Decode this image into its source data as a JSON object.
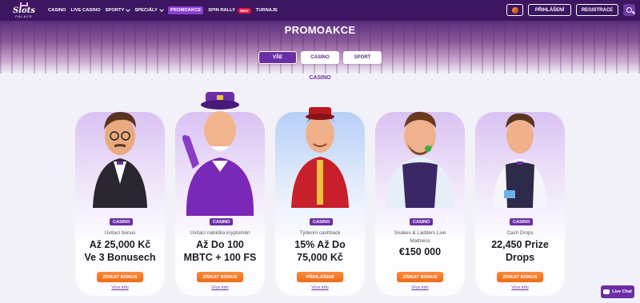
{
  "brand": {
    "name": "Slots",
    "sub": "PALACE"
  },
  "nav": {
    "items": [
      {
        "label": "CASINO"
      },
      {
        "label": "LIVE CASINO"
      },
      {
        "label": "SPORTY"
      },
      {
        "label": "SPECIÁLY"
      },
      {
        "label": "PROMOAKCE"
      },
      {
        "label": "SPIN RALLY"
      },
      {
        "label": "TURNAJE"
      }
    ],
    "new_badge": "NEW",
    "login": "PŘIHLÁŠENÍ",
    "register": "REGISTRACE"
  },
  "hero": {
    "title": "PROMOAKCE"
  },
  "filters": [
    "VŠE",
    "CASINO",
    "SPORT"
  ],
  "section_label": "CASINO",
  "cards": [
    {
      "tag": "CASINO",
      "subtitle": "Uvítací bonus",
      "title_1": "Až 25,000 Kč",
      "title_2": "Ve 3 Bonusech",
      "button": "ZÍSKAT BONUS",
      "link": "Více info"
    },
    {
      "tag": "CASINO",
      "subtitle": "Uvítací nabídka kryptoměn",
      "title_1": "Až Do 100",
      "title_2": "MBTC + 100 FS",
      "button": "ZÍSKAT BONUS",
      "link": "Více info"
    },
    {
      "tag": "CASINO",
      "subtitle": "Týdenní cashback",
      "title_1": "15% Až Do",
      "title_2": "75,000 Kč",
      "button": "PŘIHLÁŠENÍ",
      "link": "Více info"
    },
    {
      "tag": "CASINO",
      "subtitle_1": "Snakes & Ladders Live",
      "subtitle_2": "Madness",
      "title_1": "€150 000",
      "button": "ZÍSKAT BONUS",
      "link": "Více info"
    },
    {
      "tag": "CASINO",
      "subtitle": "Cash Drops",
      "title_1": "22,450 Prize",
      "title_2": "Drops",
      "button": "ZÍSKAT BONUS",
      "link": "Více info"
    }
  ],
  "live_chat": "Live Chat"
}
